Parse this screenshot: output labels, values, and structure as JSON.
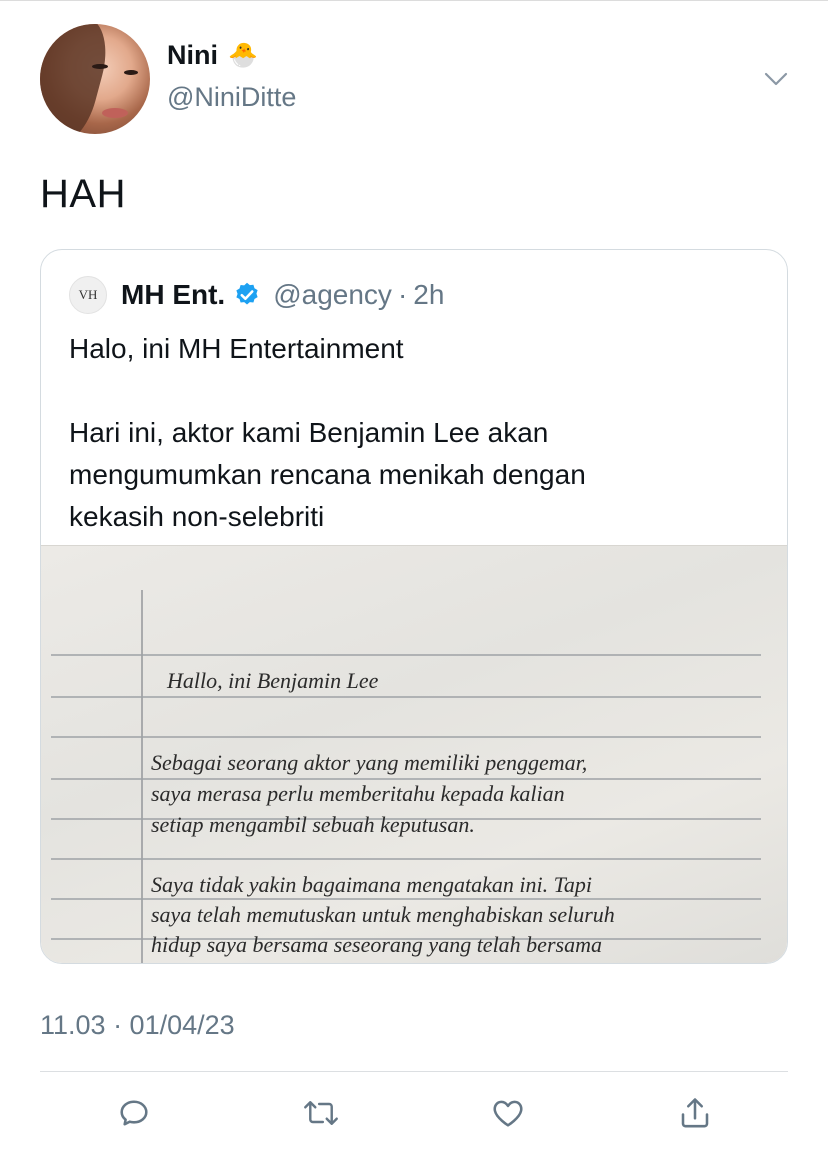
{
  "author": {
    "name": "Nini",
    "name_emoji": "🐣",
    "handle": "@NiniDitte"
  },
  "tweet": {
    "text": "HAH"
  },
  "quoted_tweet": {
    "logo_text": "VH",
    "name": "MH Ent.",
    "handle": "@agency",
    "separator": "·",
    "time": "2h",
    "line1": "Halo, ini MH Entertainment",
    "line2": "Hari ini, aktor kami Benjamin Lee akan",
    "line3": "mengumumkan rencana menikah dengan",
    "line4": "kekasih non-selebriti",
    "letter": {
      "line1": "Hallo, ini Benjamin Lee",
      "line2": "Sebagai seorang aktor yang memiliki penggemar,",
      "line3": "saya merasa perlu memberitahu kepada kalian",
      "line4": "setiap mengambil sebuah keputusan.",
      "line5": "Saya tidak yakin bagaimana mengatakan ini. Tapi",
      "line6": "saya telah memutuskan untuk menghabiskan seluruh",
      "line7": "hidup saya bersama seseorang yang telah bersama"
    }
  },
  "timestamp": "11.03 · 01/04/23",
  "colors": {
    "accent": "#1da1f2",
    "muted": "#657786"
  },
  "actions": [
    "reply-icon",
    "retweet-icon",
    "like-icon",
    "share-icon"
  ]
}
